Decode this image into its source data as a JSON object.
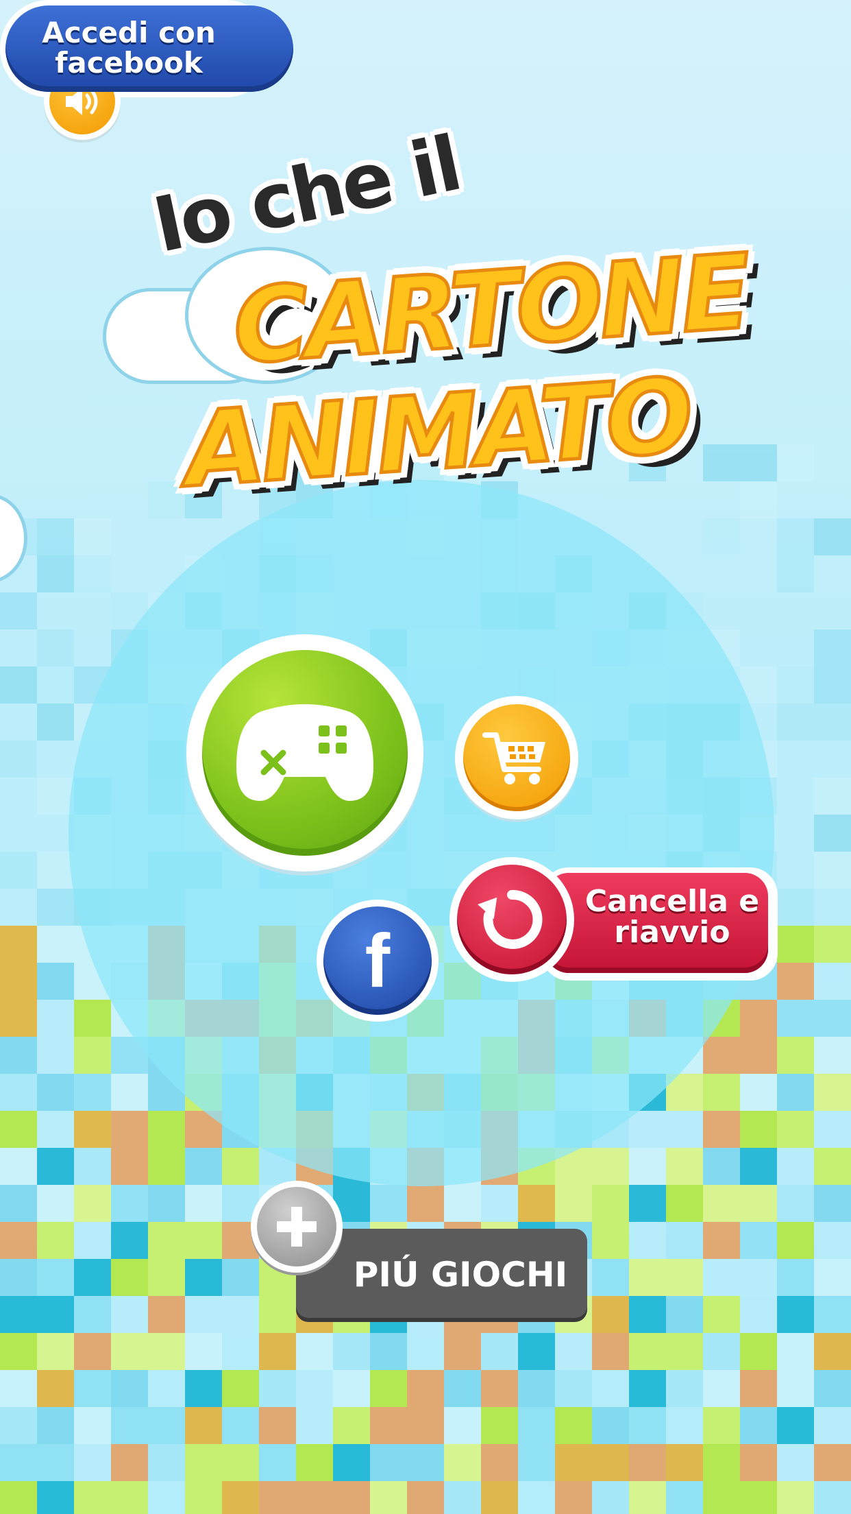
{
  "title": {
    "line1": "Io che il",
    "line2": "CARTONE",
    "line3": "ANIMATO"
  },
  "buttons": {
    "facebook_label": "Accedi con facebook",
    "facebook_icon_glyph": "f",
    "reset_label": "Cancella e riavvio",
    "more_games_label": "PIÚ GIOCHI"
  },
  "icons": {
    "sound": "speaker-icon",
    "play": "gamepad-icon",
    "shop": "shopping-cart-icon",
    "facebook": "facebook-icon",
    "reset": "restart-icon",
    "more": "plus-icon"
  },
  "colors": {
    "sky": "#c9f0fb",
    "play_green": "#7cc11b",
    "shop_orange": "#f29a00",
    "facebook_blue": "#1f47a8",
    "reset_red": "#c41335",
    "more_grey": "#5b5b5b",
    "title_yellow": "#ffc21a"
  }
}
